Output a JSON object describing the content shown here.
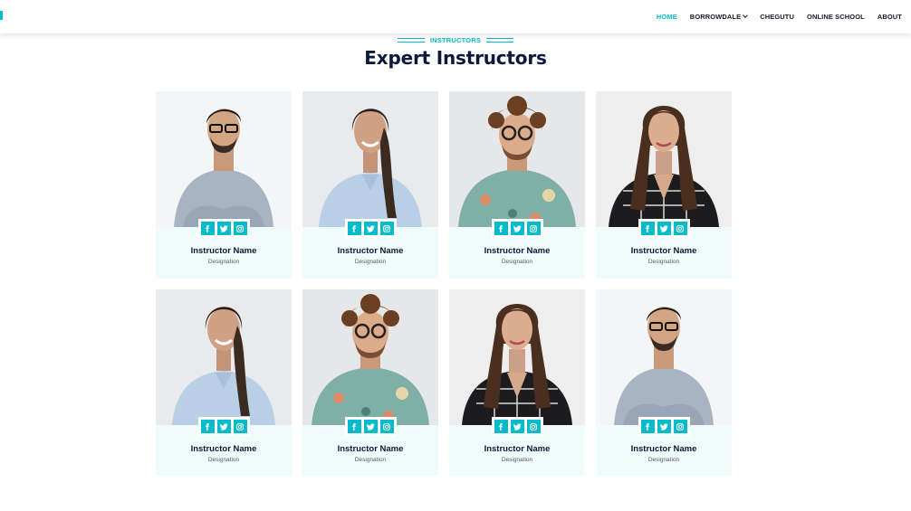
{
  "nav": {
    "items": [
      {
        "label": "HOME",
        "active": true
      },
      {
        "label": "BORROWDALE",
        "dropdown": true
      },
      {
        "label": "CHEGUTU"
      },
      {
        "label": "ONLINE SCHOOL"
      },
      {
        "label": "ABOUT"
      }
    ]
  },
  "section": {
    "eyebrow": "INSTRUCTORS",
    "title": "Expert Instructors"
  },
  "colors": {
    "accent": "#06bbcc",
    "heading": "#0b1a3a",
    "card_bg": "#f0fbfc"
  },
  "socials": [
    "facebook-icon",
    "twitter-icon",
    "instagram-icon"
  ],
  "instructors": [
    {
      "name": "Instructor Name",
      "designation": "Designation",
      "photo": "man-glasses-grey-tshirt"
    },
    {
      "name": "Instructor Name",
      "designation": "Designation",
      "photo": "woman-braid-blue-shirt"
    },
    {
      "name": "Instructor Name",
      "designation": "Designation",
      "photo": "man-curly-hair-floral-shirt"
    },
    {
      "name": "Instructor Name",
      "designation": "Designation",
      "photo": "woman-long-hair-plaid-shirt"
    },
    {
      "name": "Instructor Name",
      "designation": "Designation",
      "photo": "woman-braid-blue-shirt"
    },
    {
      "name": "Instructor Name",
      "designation": "Designation",
      "photo": "man-curly-hair-floral-shirt"
    },
    {
      "name": "Instructor Name",
      "designation": "Designation",
      "photo": "woman-long-hair-plaid-shirt"
    },
    {
      "name": "Instructor Name",
      "designation": "Designation",
      "photo": "man-glasses-grey-tshirt"
    }
  ]
}
